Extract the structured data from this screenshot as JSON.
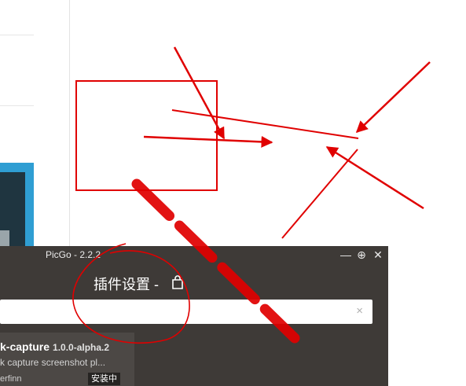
{
  "window": {
    "title": "PicGo - 2.2.2",
    "minimize_glyph": "—",
    "maximize_glyph": "⊕",
    "close_glyph": "✕"
  },
  "plugin_settings": {
    "heading": "插件设置 -",
    "shop_icon": "bag-icon",
    "search": {
      "value": "",
      "placeholder": "",
      "clear_glyph": "×"
    },
    "plugin": {
      "name": "k-capture",
      "version": "1.0.0-alpha.2",
      "description": "k capture screenshot pl...",
      "author": "erfinn",
      "status": "安装中"
    }
  },
  "colors": {
    "annotation_red": "#e00000",
    "window_bg": "#3e3a37",
    "card_bg": "#4c4845"
  }
}
